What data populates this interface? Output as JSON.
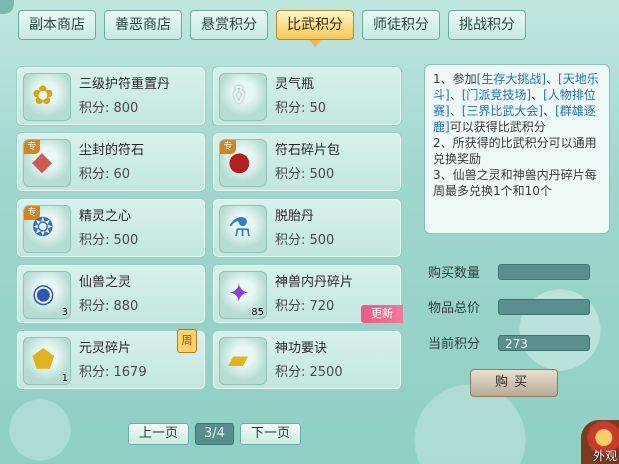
{
  "tabs": [
    {
      "label": "副本商店",
      "active": false
    },
    {
      "label": "善恶商店",
      "active": false
    },
    {
      "label": "悬赏积分",
      "active": false
    },
    {
      "label": "比武积分",
      "active": true
    },
    {
      "label": "师徒积分",
      "active": false
    },
    {
      "label": "挑战积分",
      "active": false
    }
  ],
  "items": [
    {
      "name": "三级护符重置丹",
      "price": "积分: 800",
      "icon": "golden-talisman-icon"
    },
    {
      "name": "灵气瓶",
      "price": "积分: 50",
      "icon": "spirit-bottle-icon"
    },
    {
      "name": "尘封的符石",
      "price": "积分: 60",
      "icon": "rune-stone-icon",
      "badge": "专"
    },
    {
      "name": "符石碎片包",
      "price": "积分: 500",
      "icon": "rune-bag-icon",
      "badge": "专"
    },
    {
      "name": "精灵之心",
      "price": "积分: 500",
      "icon": "elf-heart-icon",
      "badge": "专"
    },
    {
      "name": "脱胎丹",
      "price": "积分: 500",
      "icon": "rebirth-pill-icon"
    },
    {
      "name": "仙兽之灵",
      "price": "积分: 880",
      "icon": "beast-spirit-icon",
      "qty": "3"
    },
    {
      "name": "神兽内丹碎片",
      "price": "积分: 720",
      "icon": "crystal-shard-icon",
      "qty": "85",
      "tag": "更新"
    },
    {
      "name": "元灵碎片",
      "price": "积分: 1679",
      "icon": "gold-shard-icon",
      "qty": "1",
      "tag": "周"
    },
    {
      "name": "神功要诀",
      "price": "积分: 2500",
      "icon": "skill-book-icon"
    }
  ],
  "info": {
    "line1_pre": "1、参加",
    "l1": "[生存大挑战]",
    "sep1": "、",
    "l2": "[天地乐斗]",
    "sep2": "、",
    "l3": "[门派竞技场]",
    "sep3": "、",
    "l4": "[人物排位赛]",
    "sep4": "、",
    "l5": "[三界比武大会]",
    "sep5": "、",
    "l6": "[群雄逐鹿]",
    "line1_post": "可以获得比武积分",
    "line2": "2、所获得的比武积分可以通用兑换奖励",
    "line3": "3、仙兽之灵和神兽内丹碎片每周最多兑换1个和10个"
  },
  "fields": {
    "buy_qty_label": "购买数量",
    "buy_qty_value": "",
    "total_label": "物品总价",
    "total_value": "",
    "current_label": "当前积分",
    "current_value": "273"
  },
  "buy_label": "购买",
  "pager": {
    "prev": "上一页",
    "page": "3/4",
    "next": "下一页"
  },
  "corner_text": "外观"
}
